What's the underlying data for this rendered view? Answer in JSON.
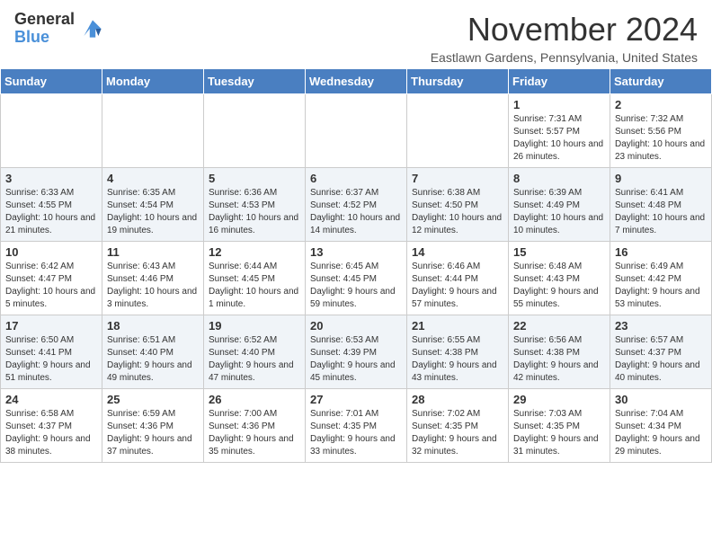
{
  "header": {
    "logo_general": "General",
    "logo_blue": "Blue",
    "month_title": "November 2024",
    "subtitle": "Eastlawn Gardens, Pennsylvania, United States"
  },
  "columns": [
    "Sunday",
    "Monday",
    "Tuesday",
    "Wednesday",
    "Thursday",
    "Friday",
    "Saturday"
  ],
  "weeks": [
    [
      {
        "day": "",
        "info": ""
      },
      {
        "day": "",
        "info": ""
      },
      {
        "day": "",
        "info": ""
      },
      {
        "day": "",
        "info": ""
      },
      {
        "day": "",
        "info": ""
      },
      {
        "day": "1",
        "info": "Sunrise: 7:31 AM\nSunset: 5:57 PM\nDaylight: 10 hours and 26 minutes."
      },
      {
        "day": "2",
        "info": "Sunrise: 7:32 AM\nSunset: 5:56 PM\nDaylight: 10 hours and 23 minutes."
      }
    ],
    [
      {
        "day": "3",
        "info": "Sunrise: 6:33 AM\nSunset: 4:55 PM\nDaylight: 10 hours and 21 minutes."
      },
      {
        "day": "4",
        "info": "Sunrise: 6:35 AM\nSunset: 4:54 PM\nDaylight: 10 hours and 19 minutes."
      },
      {
        "day": "5",
        "info": "Sunrise: 6:36 AM\nSunset: 4:53 PM\nDaylight: 10 hours and 16 minutes."
      },
      {
        "day": "6",
        "info": "Sunrise: 6:37 AM\nSunset: 4:52 PM\nDaylight: 10 hours and 14 minutes."
      },
      {
        "day": "7",
        "info": "Sunrise: 6:38 AM\nSunset: 4:50 PM\nDaylight: 10 hours and 12 minutes."
      },
      {
        "day": "8",
        "info": "Sunrise: 6:39 AM\nSunset: 4:49 PM\nDaylight: 10 hours and 10 minutes."
      },
      {
        "day": "9",
        "info": "Sunrise: 6:41 AM\nSunset: 4:48 PM\nDaylight: 10 hours and 7 minutes."
      }
    ],
    [
      {
        "day": "10",
        "info": "Sunrise: 6:42 AM\nSunset: 4:47 PM\nDaylight: 10 hours and 5 minutes."
      },
      {
        "day": "11",
        "info": "Sunrise: 6:43 AM\nSunset: 4:46 PM\nDaylight: 10 hours and 3 minutes."
      },
      {
        "day": "12",
        "info": "Sunrise: 6:44 AM\nSunset: 4:45 PM\nDaylight: 10 hours and 1 minute."
      },
      {
        "day": "13",
        "info": "Sunrise: 6:45 AM\nSunset: 4:45 PM\nDaylight: 9 hours and 59 minutes."
      },
      {
        "day": "14",
        "info": "Sunrise: 6:46 AM\nSunset: 4:44 PM\nDaylight: 9 hours and 57 minutes."
      },
      {
        "day": "15",
        "info": "Sunrise: 6:48 AM\nSunset: 4:43 PM\nDaylight: 9 hours and 55 minutes."
      },
      {
        "day": "16",
        "info": "Sunrise: 6:49 AM\nSunset: 4:42 PM\nDaylight: 9 hours and 53 minutes."
      }
    ],
    [
      {
        "day": "17",
        "info": "Sunrise: 6:50 AM\nSunset: 4:41 PM\nDaylight: 9 hours and 51 minutes."
      },
      {
        "day": "18",
        "info": "Sunrise: 6:51 AM\nSunset: 4:40 PM\nDaylight: 9 hours and 49 minutes."
      },
      {
        "day": "19",
        "info": "Sunrise: 6:52 AM\nSunset: 4:40 PM\nDaylight: 9 hours and 47 minutes."
      },
      {
        "day": "20",
        "info": "Sunrise: 6:53 AM\nSunset: 4:39 PM\nDaylight: 9 hours and 45 minutes."
      },
      {
        "day": "21",
        "info": "Sunrise: 6:55 AM\nSunset: 4:38 PM\nDaylight: 9 hours and 43 minutes."
      },
      {
        "day": "22",
        "info": "Sunrise: 6:56 AM\nSunset: 4:38 PM\nDaylight: 9 hours and 42 minutes."
      },
      {
        "day": "23",
        "info": "Sunrise: 6:57 AM\nSunset: 4:37 PM\nDaylight: 9 hours and 40 minutes."
      }
    ],
    [
      {
        "day": "24",
        "info": "Sunrise: 6:58 AM\nSunset: 4:37 PM\nDaylight: 9 hours and 38 minutes."
      },
      {
        "day": "25",
        "info": "Sunrise: 6:59 AM\nSunset: 4:36 PM\nDaylight: 9 hours and 37 minutes."
      },
      {
        "day": "26",
        "info": "Sunrise: 7:00 AM\nSunset: 4:36 PM\nDaylight: 9 hours and 35 minutes."
      },
      {
        "day": "27",
        "info": "Sunrise: 7:01 AM\nSunset: 4:35 PM\nDaylight: 9 hours and 33 minutes."
      },
      {
        "day": "28",
        "info": "Sunrise: 7:02 AM\nSunset: 4:35 PM\nDaylight: 9 hours and 32 minutes."
      },
      {
        "day": "29",
        "info": "Sunrise: 7:03 AM\nSunset: 4:35 PM\nDaylight: 9 hours and 31 minutes."
      },
      {
        "day": "30",
        "info": "Sunrise: 7:04 AM\nSunset: 4:34 PM\nDaylight: 9 hours and 29 minutes."
      }
    ]
  ]
}
